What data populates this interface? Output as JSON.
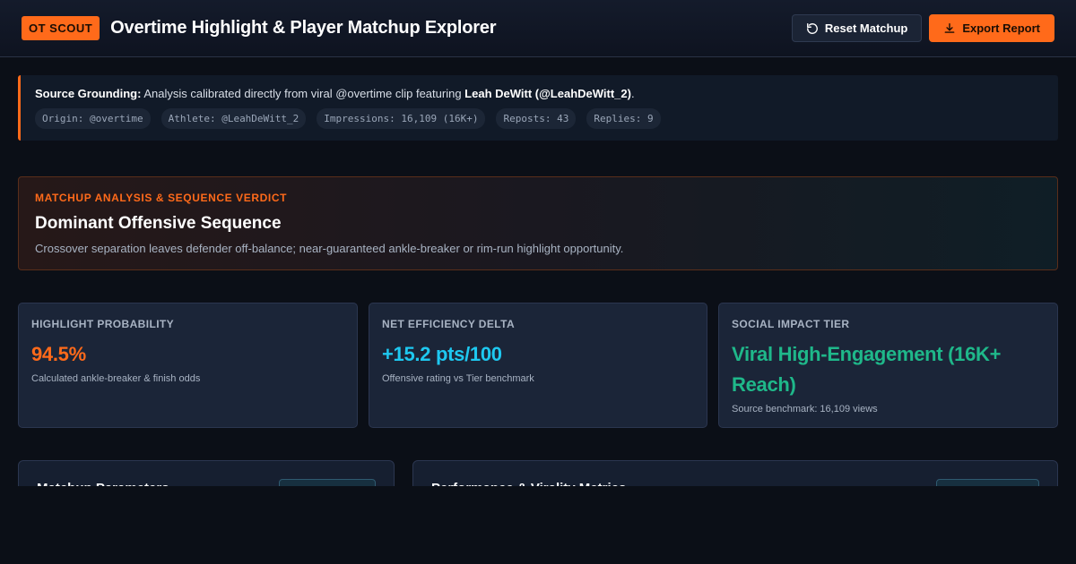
{
  "header": {
    "brand": "OT SCOUT",
    "title": "Overtime Highlight & Player Matchup Explorer",
    "reset_label": "Reset Matchup",
    "export_label": "Export Report"
  },
  "source": {
    "lead": "Source Grounding:",
    "text": " Analysis calibrated directly from viral @overtime clip featuring ",
    "athlete_bold": "Leah DeWitt (@LeahDeWitt_2)",
    "tail": ".",
    "chips": [
      "Origin: @overtime",
      "Athlete: @LeahDeWitt_2",
      "Impressions: 16,109 (16K+)",
      "Reposts: 43",
      "Replies: 9"
    ]
  },
  "verdict": {
    "kicker": "MATCHUP ANALYSIS & SEQUENCE VERDICT",
    "title": "Dominant Offensive Sequence",
    "description": "Crossover separation leaves defender off-balance; near-guaranteed ankle-breaker or rim-run highlight opportunity."
  },
  "kpis": [
    {
      "label": "HIGHLIGHT PROBABILITY",
      "value": "94.5%",
      "sub": "Calculated ankle-breaker & finish odds",
      "color": "#ff6a1a"
    },
    {
      "label": "NET EFFICIENCY DELTA",
      "value": "+15.2 pts/100",
      "sub": "Offensive rating vs Tier benchmark",
      "color": "#1ec8f0"
    },
    {
      "label": "SOCIAL IMPACT TIER",
      "value": "Viral High-Engagement (16K+ Reach)",
      "sub": "Source benchmark: 16,109 views",
      "color": "#1fb88a"
    }
  ],
  "panels": {
    "left_title": "Matchup Parameters",
    "right_title": "Performance & Virality Metrics"
  },
  "colors": {
    "accent": "#ff6a1a",
    "cyan": "#1ec8f0",
    "green": "#1fb88a",
    "background": "#0b0f17"
  }
}
